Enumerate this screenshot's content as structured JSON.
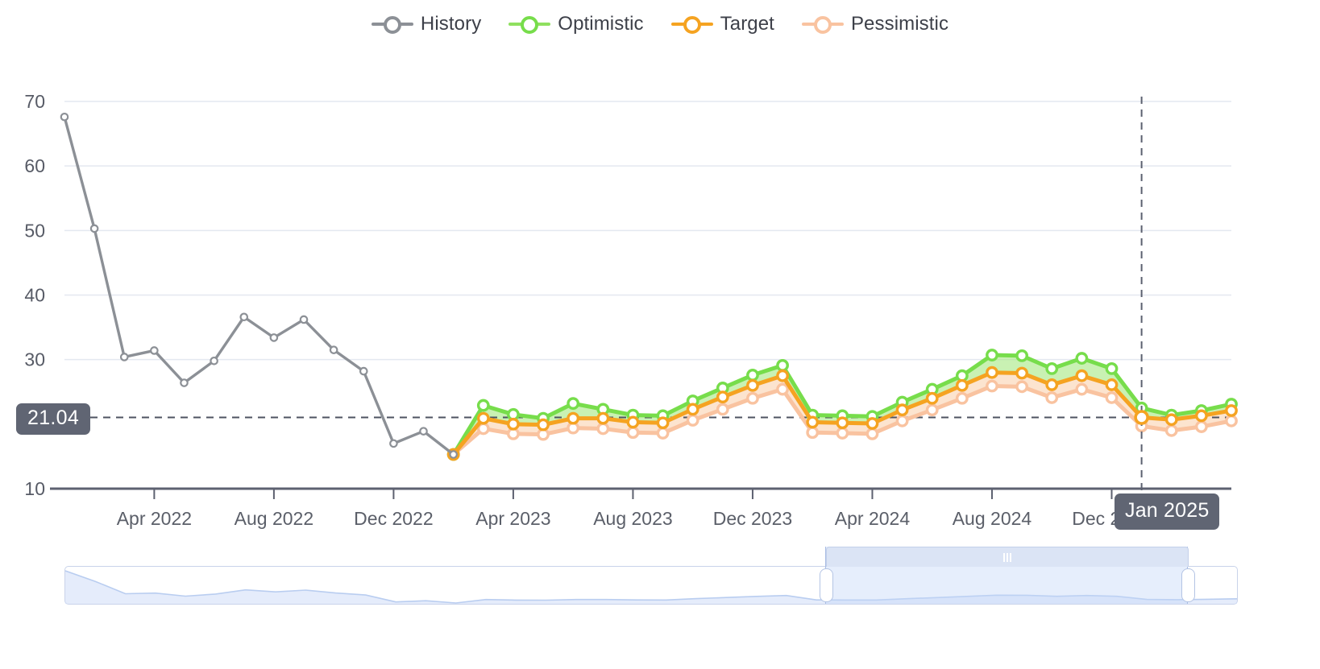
{
  "legend": {
    "items": [
      {
        "label": "History",
        "color": "#8c9096",
        "icon": "line-marker-icon"
      },
      {
        "label": "Optimistic",
        "color": "#77dd4b",
        "icon": "line-marker-icon"
      },
      {
        "label": "Target",
        "color": "#f5a321",
        "icon": "line-marker-icon"
      },
      {
        "label": "Pessimistic",
        "color": "#f9c3a0",
        "icon": "line-marker-icon"
      }
    ]
  },
  "annotations": {
    "value_badge": "21.04",
    "date_badge": "Jan 2025"
  },
  "brush": {
    "name": "range-slider",
    "selection_start_label": "",
    "selection_end_label": ""
  },
  "chart_data": {
    "type": "line",
    "title": "",
    "xlabel": "",
    "ylabel": "",
    "ylim": [
      10,
      70
    ],
    "yticks": [
      10,
      30,
      40,
      50,
      60,
      70
    ],
    "ytick_labels": [
      "10",
      "30",
      "40",
      "50",
      "60",
      "70"
    ],
    "gridlines": true,
    "legend_position": "top-center",
    "xticks": [
      "Apr 2022",
      "Aug 2022",
      "Dec 2022",
      "Apr 2023",
      "Aug 2023",
      "Dec 2023",
      "Apr 2024",
      "Aug 2024",
      "Dec 2024"
    ],
    "x": [
      "Jan 2022",
      "Feb 2022",
      "Mar 2022",
      "Apr 2022",
      "May 2022",
      "Jun 2022",
      "Jul 2022",
      "Aug 2022",
      "Sep 2022",
      "Oct 2022",
      "Nov 2022",
      "Dec 2022",
      "Jan 2023",
      "Feb 2023",
      "Mar 2023",
      "Apr 2023",
      "May 2023",
      "Jun 2023",
      "Jul 2023",
      "Aug 2023",
      "Sep 2023",
      "Oct 2023",
      "Nov 2023",
      "Dec 2023",
      "Jan 2024",
      "Feb 2024",
      "Mar 2024",
      "Apr 2024",
      "May 2024",
      "Jun 2024",
      "Jul 2024",
      "Aug 2024",
      "Sep 2024",
      "Oct 2024",
      "Nov 2024",
      "Dec 2024",
      "Jan 2025",
      "Feb 2025",
      "Mar 2025",
      "Apr 2025"
    ],
    "reference_line_y": 21.04,
    "crosshair_x": "Jan 2025",
    "series": [
      {
        "name": "History",
        "color": "#8c9096",
        "values": [
          67.6,
          50.3,
          30.4,
          31.4,
          26.4,
          29.8,
          36.6,
          33.4,
          36.2,
          31.5,
          28.2,
          17.0,
          18.9,
          15.3,
          null,
          null,
          null,
          null,
          null,
          null,
          null,
          null,
          null,
          null,
          null,
          null,
          null,
          null,
          null,
          null,
          null,
          null,
          null,
          null,
          null,
          null,
          null,
          null,
          null,
          null
        ]
      },
      {
        "name": "Optimistic",
        "color": "#77dd4b",
        "values": [
          null,
          null,
          null,
          null,
          null,
          null,
          null,
          null,
          null,
          null,
          null,
          null,
          null,
          15.3,
          22.9,
          21.5,
          20.9,
          23.2,
          22.3,
          21.4,
          21.3,
          23.6,
          25.6,
          27.6,
          29.1,
          21.4,
          21.3,
          21.2,
          23.4,
          25.4,
          27.5,
          30.7,
          30.6,
          28.6,
          30.2,
          28.6,
          22.5,
          21.4,
          22.1,
          23.1
        ]
      },
      {
        "name": "Target",
        "color": "#f5a321",
        "values": [
          null,
          null,
          null,
          null,
          null,
          null,
          null,
          null,
          null,
          null,
          null,
          null,
          null,
          15.3,
          20.9,
          20.0,
          19.9,
          20.9,
          20.9,
          20.3,
          20.2,
          22.3,
          24.2,
          26.0,
          27.5,
          20.3,
          20.2,
          20.1,
          22.2,
          24.0,
          26.0,
          28.0,
          27.9,
          26.1,
          27.5,
          26.1,
          21.04,
          20.7,
          21.3,
          22.1
        ]
      },
      {
        "name": "Pessimistic",
        "color": "#f9c3a0",
        "values": [
          null,
          null,
          null,
          null,
          null,
          null,
          null,
          null,
          null,
          null,
          null,
          null,
          null,
          15.3,
          19.3,
          18.5,
          18.4,
          19.4,
          19.3,
          18.7,
          18.6,
          20.6,
          22.3,
          24.0,
          25.4,
          18.7,
          18.6,
          18.5,
          20.5,
          22.2,
          24.0,
          25.9,
          25.8,
          24.1,
          25.4,
          24.1,
          19.7,
          19.0,
          19.6,
          20.5
        ]
      }
    ]
  }
}
